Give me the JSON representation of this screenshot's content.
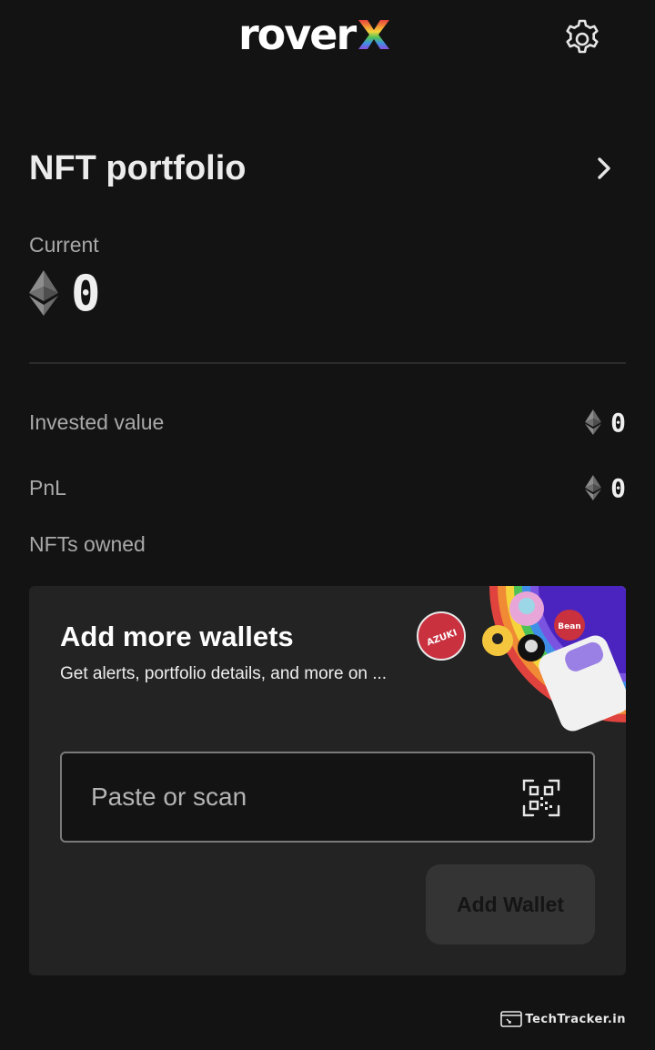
{
  "header": {
    "logo_text": "rover",
    "logo_suffix_icon": "rainbow-x-icon",
    "settings_icon": "gear-icon"
  },
  "portfolio": {
    "title": "NFT portfolio",
    "current_label": "Current",
    "current_value": "0",
    "currency_icon": "ethereum-icon",
    "stats": [
      {
        "label": "Invested value",
        "value": "0"
      },
      {
        "label": "PnL",
        "value": "0"
      },
      {
        "label": "NFTs owned"
      }
    ]
  },
  "wallet_card": {
    "title": "Add more wallets",
    "subtitle": "Get alerts, portfolio details, and more on ...",
    "input_placeholder": "Paste or scan",
    "scan_icon": "qr-scan-icon",
    "button_label": "Add Wallet"
  },
  "watermark": {
    "text": "TechTracker.in"
  },
  "colors": {
    "background": "#131313",
    "card": "#232323",
    "button_disabled": "#343434"
  }
}
